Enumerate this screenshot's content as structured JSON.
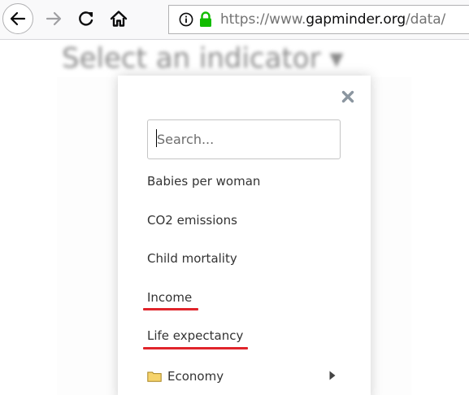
{
  "browser": {
    "url_prefix": "https://www.",
    "url_domain": "gapminder.org",
    "url_path": "/data/"
  },
  "page": {
    "heading": "Select an indicator ▾"
  },
  "modal": {
    "search_placeholder": "Search...",
    "items": [
      {
        "label": "Babies per woman",
        "underlined": false
      },
      {
        "label": "CO2 emissions",
        "underlined": false
      },
      {
        "label": "Child mortality",
        "underlined": false
      },
      {
        "label": "Income",
        "underlined": true
      },
      {
        "label": "Life expectancy",
        "underlined": true
      }
    ],
    "folder": {
      "label": "Economy",
      "icon": "folder-icon"
    }
  },
  "colors": {
    "underline": "#e0242b",
    "lock": "#12bc00",
    "folder": "#f6d36b"
  }
}
